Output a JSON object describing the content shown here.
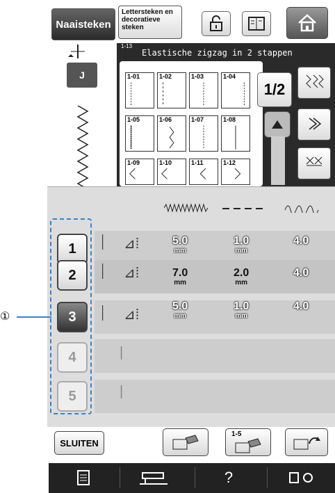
{
  "header": {
    "tab_active": "Naaisteken",
    "tab_inactive": "Lettersteken en decoratieve steken",
    "lock_icon": "lock-icon",
    "manual_icon": "book-icon",
    "home_icon": "home-icon"
  },
  "presser_foot": "J",
  "pattern": {
    "number": "1-13",
    "title": "Elastische zigzag in 2 stappen",
    "page": "1/2",
    "cells": [
      "1-01",
      "1-02",
      "1-03",
      "1-04",
      "1-05",
      "1-06",
      "1-07",
      "1-08",
      "1-09",
      "1-10",
      "1-11",
      "1-12"
    ]
  },
  "columns": {
    "width_icon": "stitch-width-icon",
    "length_icon": "stitch-length-icon",
    "tension_icon": "tension-icon"
  },
  "rows": [
    {
      "num": "1",
      "state": "normal",
      "width": "5.0",
      "length": "1.0",
      "tension": "4.0",
      "unit": "mm"
    },
    {
      "num": "2",
      "state": "normal",
      "width": "7.0",
      "length": "2.0",
      "tension": "4.0",
      "unit": "mm"
    },
    {
      "num": "3",
      "state": "selected",
      "width": "5.0",
      "length": "1.0",
      "tension": "4.0",
      "unit": "mm"
    },
    {
      "num": "4",
      "state": "disabled"
    },
    {
      "num": "5",
      "state": "disabled"
    }
  ],
  "callout": "①",
  "footer": {
    "close_label": "SLUITEN",
    "range_label": "1-5"
  },
  "colors": {
    "selection_outline": "#3b82c4",
    "bottom_bar": "#222222"
  }
}
